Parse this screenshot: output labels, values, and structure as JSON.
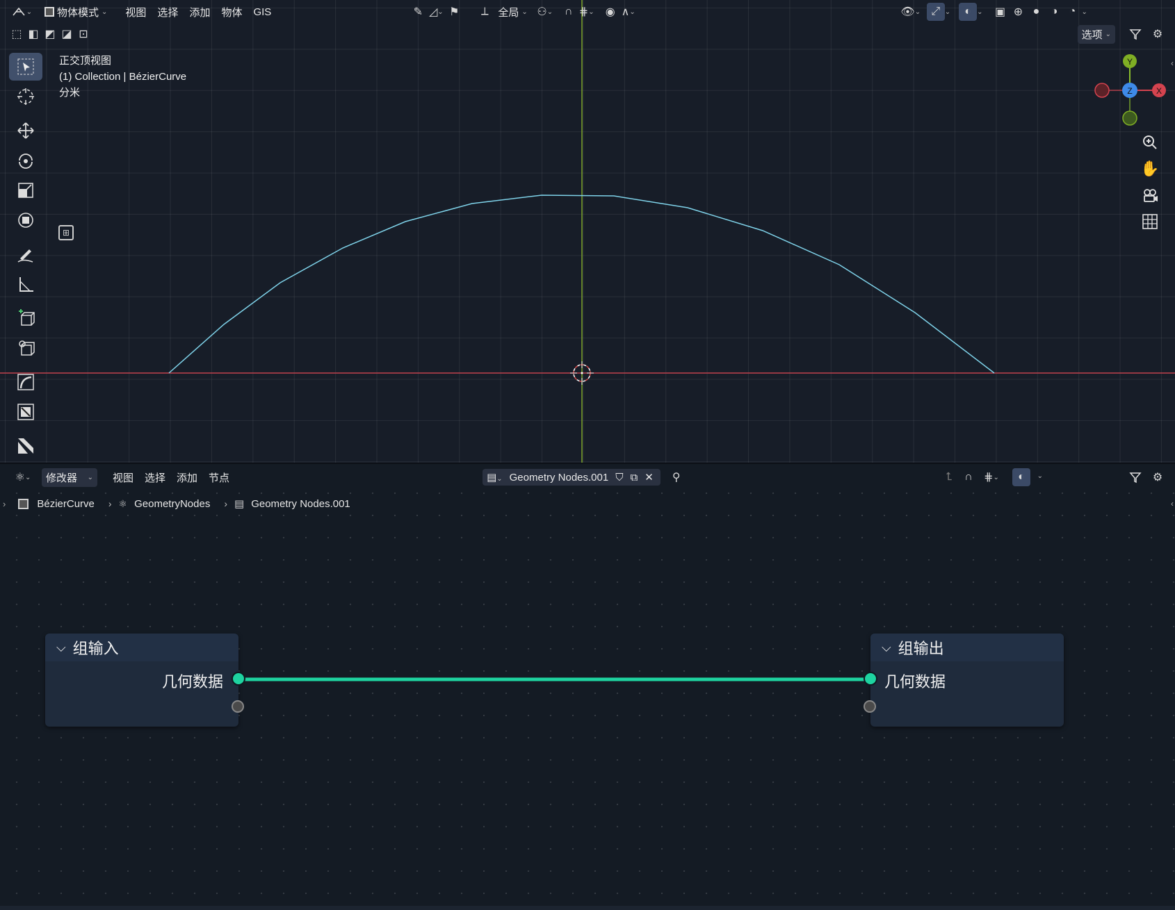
{
  "viewport": {
    "header": {
      "mode_label": "物体模式",
      "menus": [
        "视图",
        "选择",
        "添加",
        "物体",
        "GIS"
      ],
      "transform_orientation": "全局",
      "options_label": "选项"
    },
    "overlay": {
      "view_name": "正交顶视图",
      "collection_line": "(1) Collection | BézierCurve",
      "units": "分米"
    },
    "gizmo": {
      "y": "Y",
      "z": "Z",
      "x": "X"
    },
    "colors": {
      "curve": "#7fd3ea",
      "x_axis": "#c0434e",
      "y_axis": "#7da32b",
      "grid_bg": "#171d28"
    }
  },
  "node_editor": {
    "header": {
      "editor_type": "修改器",
      "menus": [
        "视图",
        "选择",
        "添加",
        "节点"
      ],
      "node_group_name": "Geometry Nodes.001"
    },
    "breadcrumb": [
      "BézierCurve",
      "GeometryNodes",
      "Geometry Nodes.001"
    ],
    "nodes": {
      "group_input": {
        "title": "组输入",
        "socket_label": "几何数据"
      },
      "group_output": {
        "title": "组输出",
        "socket_label": "几何数据"
      }
    },
    "colors": {
      "link": "#1ed3a0"
    }
  }
}
